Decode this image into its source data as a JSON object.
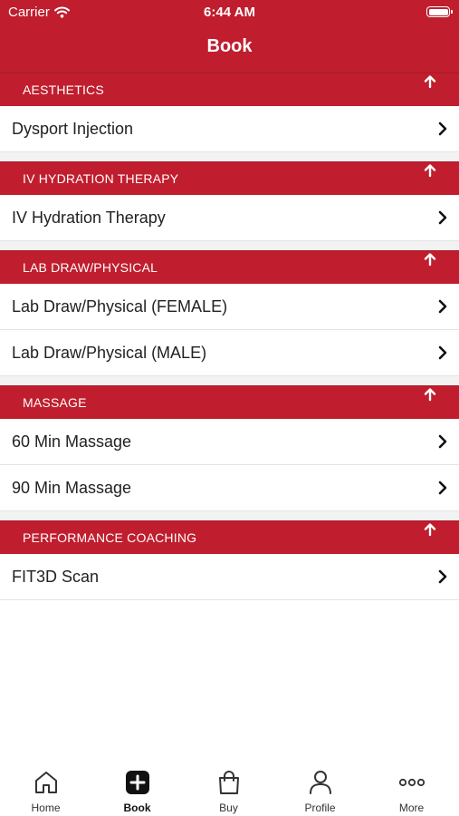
{
  "status_bar": {
    "carrier": "Carrier",
    "time": "6:44 AM"
  },
  "header": {
    "title": "Book"
  },
  "sections": [
    {
      "title": "AESTHETICS",
      "items": [
        {
          "label": "Dysport Injection"
        }
      ]
    },
    {
      "title": "IV HYDRATION THERAPY",
      "items": [
        {
          "label": "IV Hydration Therapy"
        }
      ]
    },
    {
      "title": "LAB DRAW/PHYSICAL",
      "items": [
        {
          "label": "Lab Draw/Physical (FEMALE)"
        },
        {
          "label": "Lab Draw/Physical (MALE)"
        }
      ]
    },
    {
      "title": "MASSAGE",
      "items": [
        {
          "label": "60 Min Massage"
        },
        {
          "label": "90 Min Massage"
        }
      ]
    },
    {
      "title": "PERFORMANCE COACHING",
      "items": [
        {
          "label": "FIT3D Scan"
        }
      ]
    }
  ],
  "tabbar": {
    "tabs": [
      {
        "label": "Home",
        "icon": "home-icon"
      },
      {
        "label": "Book",
        "icon": "plus-square-icon",
        "active": true
      },
      {
        "label": "Buy",
        "icon": "shopping-bag-icon"
      },
      {
        "label": "Profile",
        "icon": "person-icon"
      },
      {
        "label": "More",
        "icon": "more-dots-icon"
      }
    ]
  },
  "colors": {
    "brand": "#c01e2e",
    "separator": "#e4e4e4",
    "text": "#222222"
  }
}
